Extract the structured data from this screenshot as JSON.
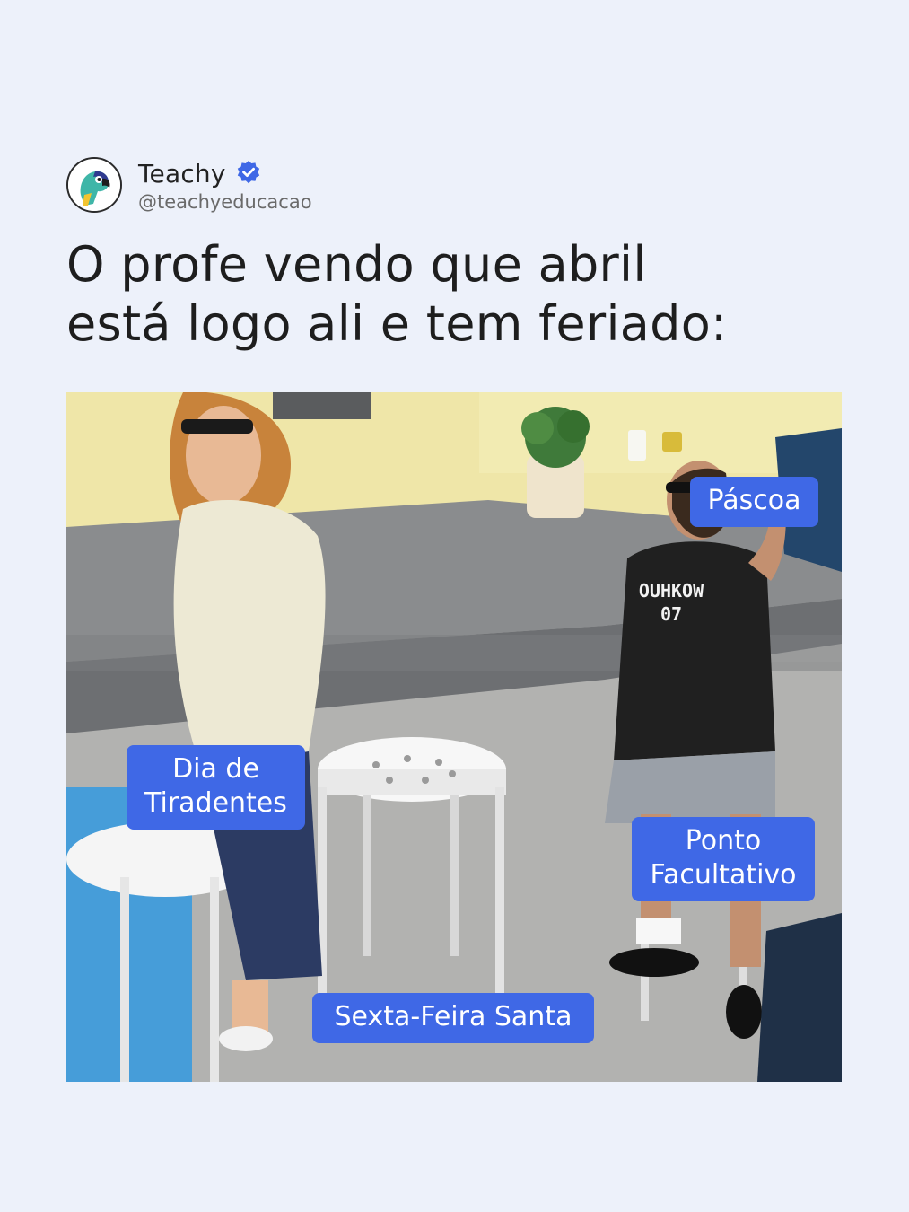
{
  "account": {
    "name": "Teachy",
    "handle": "@teachyeducacao",
    "verified": true,
    "avatar_icon": "parrot-logo-icon",
    "verified_icon": "verified-badge-icon"
  },
  "post": {
    "caption": "O profe vendo que abril\nestá logo ali e tem feriado:"
  },
  "meme": {
    "shirt_text": "OUHKOW\n07",
    "labels": {
      "pascoa": "Páscoa",
      "tiradentes": "Dia de\nTiradentes",
      "ponto": "Ponto\nFacultativo",
      "sexta": "Sexta-Feira Santa"
    }
  },
  "colors": {
    "background": "#edf1fa",
    "label_bg": "#3f68e6",
    "label_text": "#ffffff",
    "verified": "#3f68e6"
  }
}
